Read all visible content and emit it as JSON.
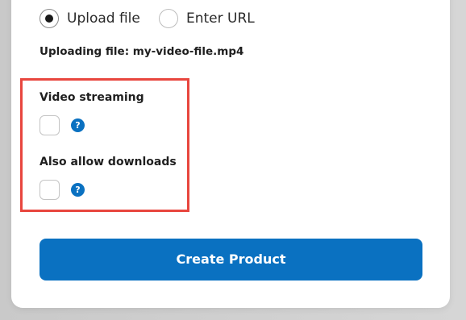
{
  "source_type": {
    "options": [
      {
        "label": "Upload file",
        "selected": true
      },
      {
        "label": "Enter URL",
        "selected": false
      }
    ]
  },
  "upload": {
    "status_text": "Uploading file: my-video-file.mp4"
  },
  "settings": {
    "video_streaming": {
      "label": "Video streaming",
      "checked": false,
      "help_icon": "?"
    },
    "allow_downloads": {
      "label": "Also allow downloads",
      "checked": false,
      "help_icon": "?"
    }
  },
  "actions": {
    "create_label": "Create Product"
  },
  "colors": {
    "primary": "#0a71c1",
    "highlight": "#e8463e",
    "text": "#1f1f1f"
  }
}
